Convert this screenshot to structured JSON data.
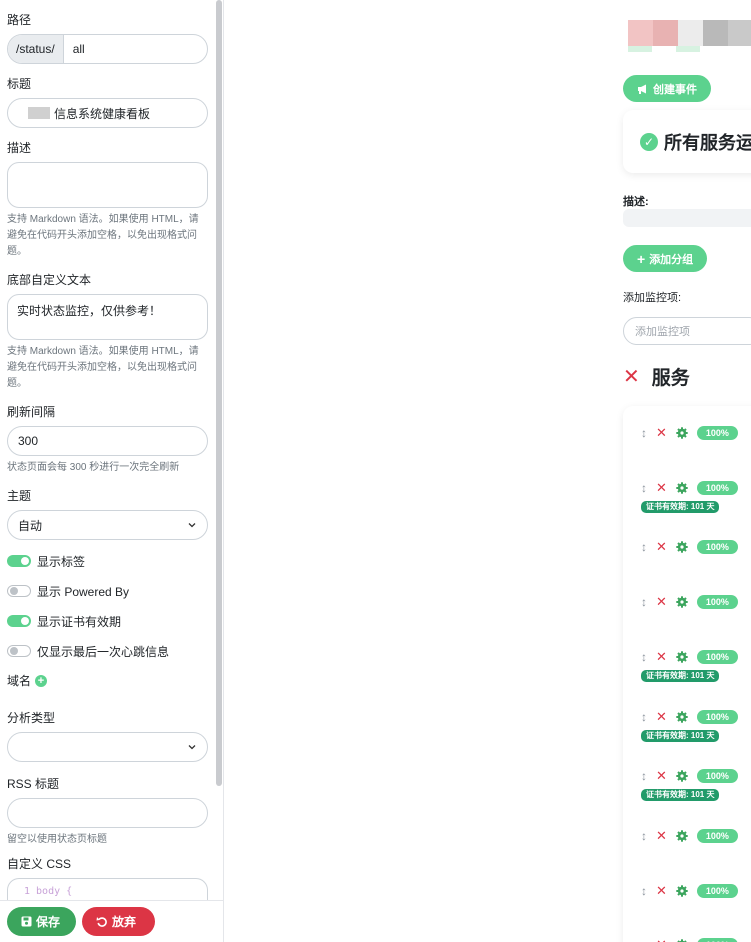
{
  "path": {
    "label": "路径",
    "prefix": "/status/",
    "value": "all"
  },
  "title": {
    "label": "标题",
    "value": "信息系统健康看板"
  },
  "description": {
    "label": "描述",
    "value": "",
    "help": "支持 Markdown 语法。如果使用 HTML，请避免在代码开头添加空格，以免出现格式问题。"
  },
  "footer": {
    "label": "底部自定义文本",
    "value": "实时状态监控，仅供参考！",
    "help": "支持 Markdown 语法。如果使用 HTML，请避免在代码开头添加空格，以免出现格式问题。"
  },
  "refresh": {
    "label": "刷新间隔",
    "value": "300",
    "help": "状态页面会每 300 秒进行一次完全刷新"
  },
  "theme": {
    "label": "主题",
    "value": "自动"
  },
  "toggles": [
    {
      "label": "显示标签",
      "on": true
    },
    {
      "label": "显示 Powered By",
      "on": false
    },
    {
      "label": "显示证书有效期",
      "on": true
    },
    {
      "label": "仅显示最后一次心跳信息",
      "on": false
    }
  ],
  "domain": {
    "label": "域名"
  },
  "analytics": {
    "label": "分析类型",
    "value": ""
  },
  "rss": {
    "label": "RSS 标题",
    "value": "",
    "help": "留空以使用状态页标题"
  },
  "custom_css": {
    "label": "自定义 CSS",
    "code": "1  body {"
  },
  "actions": {
    "save": "保存",
    "discard": "放弃"
  },
  "preview": {
    "create_incident": "创建事件",
    "status_text": "所有服务运",
    "desc_label": "描述:",
    "add_group": "添加分组",
    "add_monitor_label": "添加监控项:",
    "add_monitor_placeholder": "添加监控项",
    "group_name": "服务",
    "monitors": [
      {
        "uptime": "100%",
        "cert": ""
      },
      {
        "uptime": "100%",
        "cert": "证书有效期: 101 天"
      },
      {
        "uptime": "100%",
        "cert": ""
      },
      {
        "uptime": "100%",
        "cert": ""
      },
      {
        "uptime": "100%",
        "cert": "证书有效期: 101 天"
      },
      {
        "uptime": "100%",
        "cert": "证书有效期: 101 天"
      },
      {
        "uptime": "100%",
        "cert": "证书有效期: 101 天"
      },
      {
        "uptime": "100%",
        "cert": ""
      },
      {
        "uptime": "100%",
        "cert": ""
      },
      {
        "uptime": "100%",
        "cert": ""
      }
    ]
  },
  "colors": {
    "accent": "#5cd28e",
    "danger": "#dc3545",
    "save": "#3ba55d",
    "cert_badge": "#229b6a"
  }
}
